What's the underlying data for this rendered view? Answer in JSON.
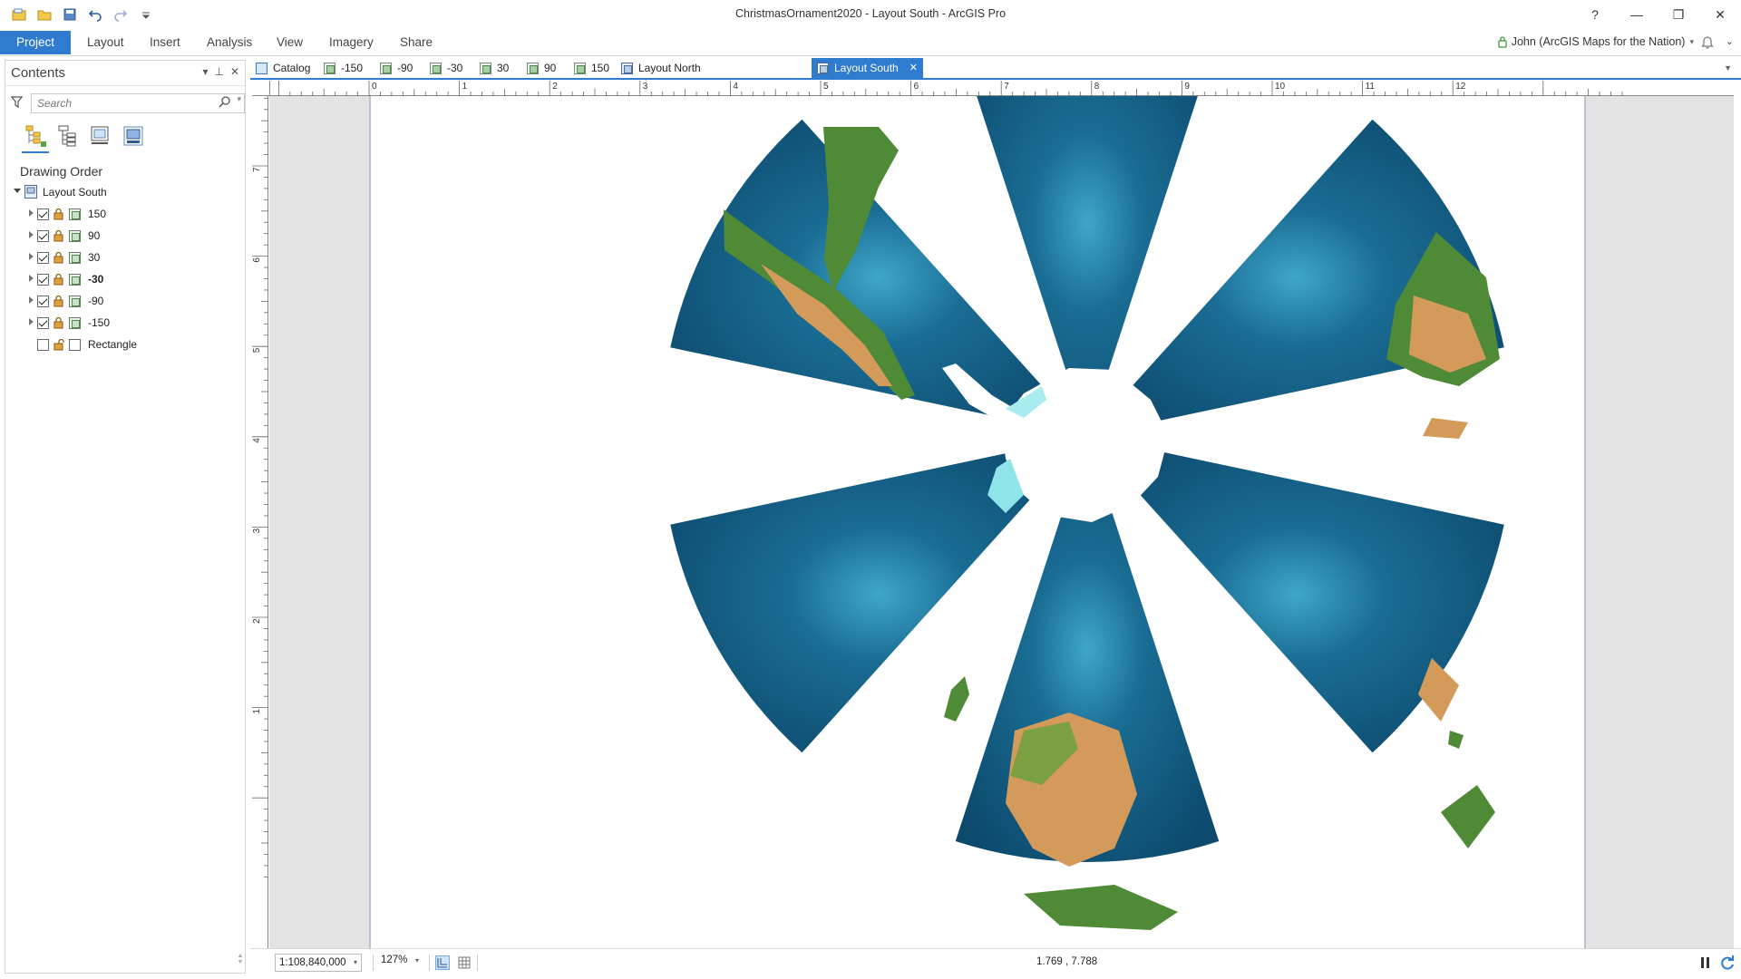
{
  "window": {
    "title": "ChristmasOrnament2020 - Layout South - ArcGIS Pro",
    "help": "?",
    "minimize": "—",
    "restore": "❐",
    "close": "✕"
  },
  "ribbon": {
    "tabs": [
      {
        "label": "Project",
        "active": true
      },
      {
        "label": "Layout"
      },
      {
        "label": "Insert"
      },
      {
        "label": "Analysis"
      },
      {
        "label": "View"
      },
      {
        "label": "Imagery"
      },
      {
        "label": "Share"
      }
    ],
    "user": "John (ArcGIS Maps for the Nation)",
    "user_caret": "▾",
    "collapse": "⌄"
  },
  "contents_pane": {
    "title": "Contents",
    "tools": {
      "dropdown": "▾",
      "pin": "⊥",
      "close": "✕"
    },
    "search_placeholder": "Search",
    "search_caret": "▾",
    "section_title": "Drawing Order",
    "root": "Layout South",
    "items": [
      {
        "label": "150",
        "checked": true,
        "bold": false
      },
      {
        "label": "90",
        "checked": true,
        "bold": false
      },
      {
        "label": "30",
        "checked": true,
        "bold": false
      },
      {
        "label": "-30",
        "checked": true,
        "bold": true
      },
      {
        "label": "-90",
        "checked": true,
        "bold": false
      },
      {
        "label": "-150",
        "checked": true,
        "bold": false
      },
      {
        "label": "Rectangle",
        "checked": false,
        "bold": false
      }
    ]
  },
  "doc_tabs": [
    {
      "label": "Catalog",
      "kind": "catalog"
    },
    {
      "label": "-150",
      "kind": "map"
    },
    {
      "label": "-90",
      "kind": "map"
    },
    {
      "label": "-30",
      "kind": "map"
    },
    {
      "label": "30",
      "kind": "map"
    },
    {
      "label": "90",
      "kind": "map"
    },
    {
      "label": "150",
      "kind": "map"
    },
    {
      "label": "Layout North",
      "kind": "layout"
    },
    {
      "label": "Layout South",
      "kind": "layout",
      "active": true
    }
  ],
  "active_tab_close": "✕",
  "ruler": {
    "horizontal_labels": [
      "0",
      "1",
      "2",
      "3",
      "4",
      "5",
      "6",
      "7",
      "8",
      "9",
      "10",
      "11",
      "12"
    ],
    "vertical_labels": [
      "7",
      "6",
      "5",
      "4",
      "3",
      "2",
      "1"
    ]
  },
  "status_bar": {
    "scale": "1:108,840,000",
    "zoom": "127%",
    "caret": "▾",
    "coordinates": "1.769 , 7.788"
  },
  "colors": {
    "accent": "#2f7bd0",
    "ocean_deep": "#0d4a6e",
    "ocean_mid": "#1a6d94",
    "ocean_shallow": "#3fa7c9",
    "land_green": "#4f8a36",
    "land_desert": "#d39a5a",
    "ice": "#ffffff"
  }
}
